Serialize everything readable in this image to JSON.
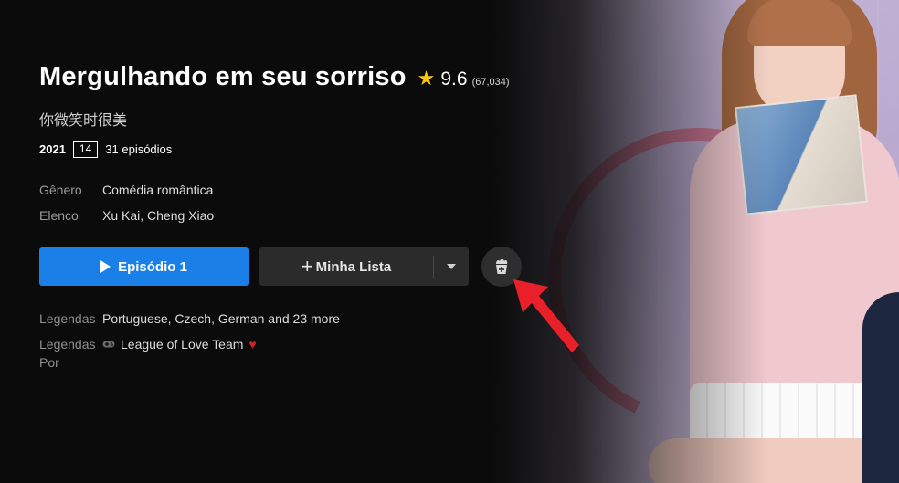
{
  "show": {
    "title": "Mergulhando em seu sorriso",
    "rating": "9.6",
    "votes": "(67,034)",
    "original_title": "你微笑时很美",
    "year": "2021",
    "age_rating": "14",
    "episodes": "31 episódios"
  },
  "details": {
    "genre_label": "Gênero",
    "genre_value": "Comédia romântica",
    "cast_label": "Elenco",
    "cast_value": "Xu Kai, Cheng Xiao"
  },
  "actions": {
    "play_label": "Episódio 1",
    "list_label": "Minha Lista"
  },
  "subtitles": {
    "label": "Legendas",
    "value": "Portuguese, Czech, German and 23 more",
    "by_label_1": "Legendas",
    "by_label_2": "Por",
    "by_value": "League of Love Team"
  },
  "colors": {
    "play_button": "#1a7fe6",
    "star": "#f5c518",
    "arrow": "#e8202a",
    "heart": "#d0202a"
  },
  "icons": {
    "star": "star-icon",
    "play": "play-icon",
    "plus": "plus-icon",
    "dropdown": "chevron-down-icon",
    "watch_party": "popcorn-add-icon",
    "gamepad": "gamepad-icon",
    "heart": "heart-icon",
    "annotation": "red-arrow-icon"
  }
}
